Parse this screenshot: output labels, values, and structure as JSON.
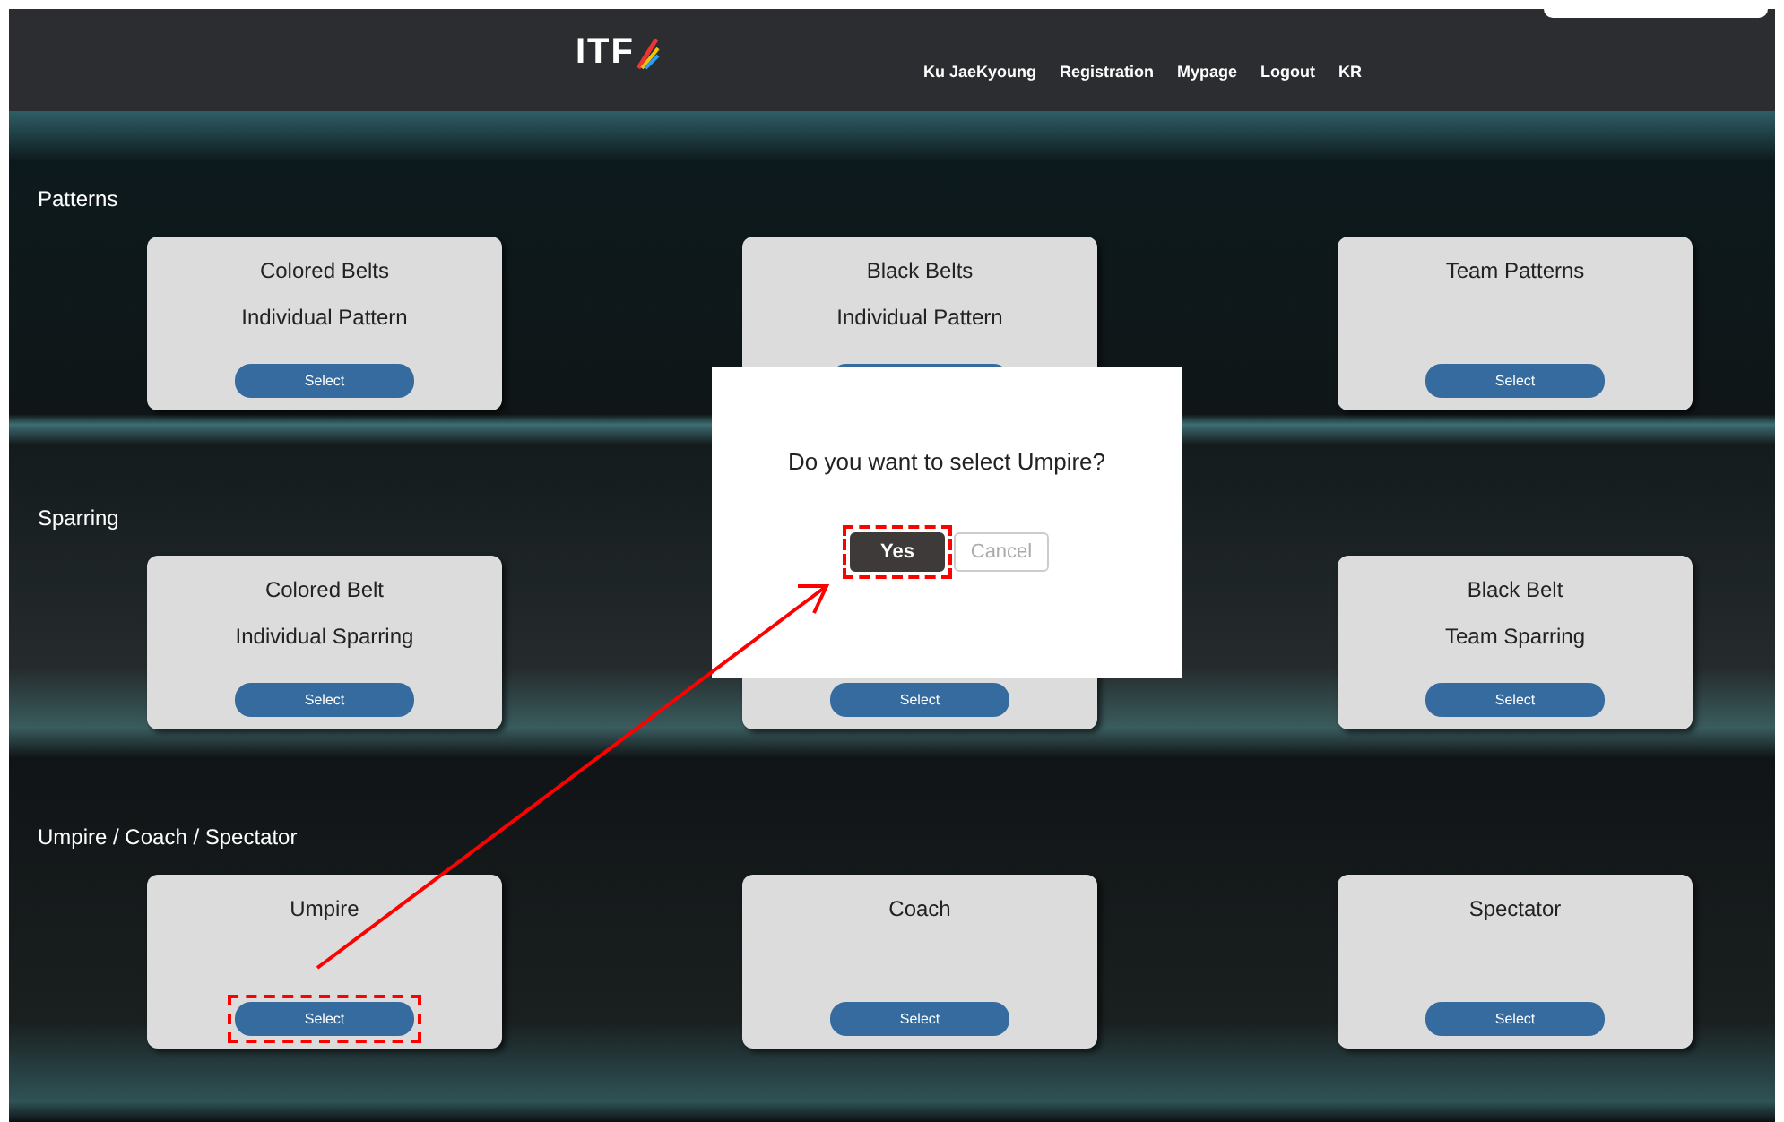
{
  "header": {
    "logo": "ITF",
    "nav": [
      "Ku JaeKyoung",
      "Registration",
      "Mypage",
      "Logout",
      "KR"
    ]
  },
  "sections": [
    {
      "title": "Patterns",
      "cards": [
        {
          "lines": [
            "Colored Belts",
            "Individual Pattern"
          ],
          "button": "Select",
          "highlighted": false
        },
        {
          "lines": [
            "Black Belts",
            "Individual Pattern"
          ],
          "highlighted": false
        },
        {
          "lines": [
            "Team Patterns"
          ],
          "button": "Select",
          "highlighted": false
        }
      ]
    },
    {
      "title": "Sparring",
      "cards": [
        {
          "lines": [
            "Colored Belt",
            "Individual Sparring"
          ],
          "button": "Select",
          "highlighted": false
        },
        {
          "button": "Select",
          "highlighted": false
        },
        {
          "lines": [
            "Black Belt",
            "Team Sparring"
          ],
          "button": "Select",
          "highlighted": false
        }
      ]
    },
    {
      "title": "Umpire / Coach / Spectator",
      "cards": [
        {
          "lines": [
            "Umpire"
          ],
          "button": "Select",
          "highlighted": true
        },
        {
          "lines": [
            "Coach"
          ],
          "button": "Select",
          "highlighted": false
        },
        {
          "lines": [
            "Spectator"
          ],
          "button": "Select",
          "highlighted": false
        }
      ]
    }
  ],
  "dialog": {
    "message": "Do you want to select Umpire?",
    "buttons": [
      {
        "label": "Yes",
        "kind": "primary",
        "highlighted": true
      },
      {
        "label": "Cancel",
        "kind": "secondary",
        "highlighted": false
      }
    ]
  },
  "annotation_arrow": true
}
